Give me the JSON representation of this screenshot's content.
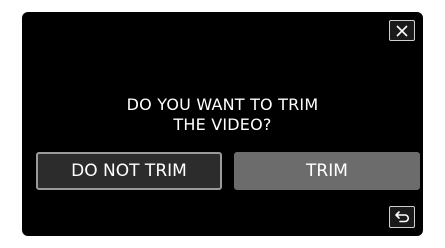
{
  "dialog": {
    "message_lines": [
      "DO YOU WANT TO TRIM",
      "THE VIDEO?"
    ],
    "buttons": {
      "do_not_trim": "DO NOT TRIM",
      "trim": "TRIM"
    }
  },
  "icons": {
    "close": "close-icon",
    "back": "return-arrow-icon"
  },
  "colors": {
    "screen_bg": "#000000",
    "button_dark": "#2c2c2c",
    "button_highlight": "#6c6c6c",
    "text": "#ffffff"
  }
}
